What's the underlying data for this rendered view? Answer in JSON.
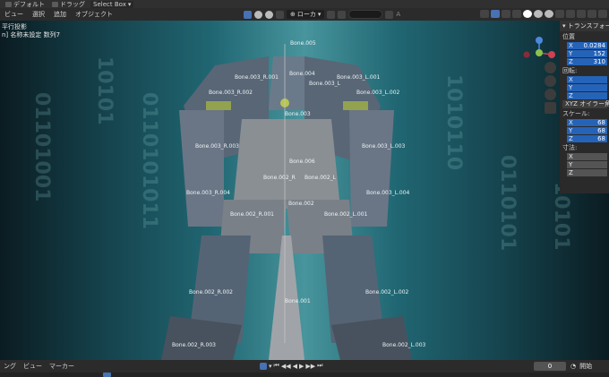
{
  "topbar": {
    "mode_label": "デフォルト",
    "drag_label": "ドラッグ",
    "select_label": "Select Box"
  },
  "header": {
    "menu": [
      "ビュー",
      "選択",
      "追加",
      "オブジェクト"
    ],
    "orientation_label": "ローカ",
    "search_placeholder": ""
  },
  "viewport": {
    "title_line1": "平行投影",
    "title_line2": "n] 名称未設定 数列7",
    "accent": "#2a8390"
  },
  "bones": [
    {
      "label": "Bone.005"
    },
    {
      "label": "Bone.004"
    },
    {
      "label": "Bone.003_R.001"
    },
    {
      "label": "Bone.003_L.001"
    },
    {
      "label": "Bone.003_L"
    },
    {
      "label": "Bone.003_R.002"
    },
    {
      "label": "Bone.003_L.002"
    },
    {
      "label": "Bone.003"
    },
    {
      "label": "Bone.003_R.003"
    },
    {
      "label": "Bone.003_L.003"
    },
    {
      "label": "Bone.006"
    },
    {
      "label": "Bone.002_R"
    },
    {
      "label": "Bone.002_L"
    },
    {
      "label": "Bone.003_R.004"
    },
    {
      "label": "Bone.003_L.004"
    },
    {
      "label": "Bone.002"
    },
    {
      "label": "Bone.002_R.001"
    },
    {
      "label": "Bone.002_L.001"
    },
    {
      "label": "Bone.002_R.002"
    },
    {
      "label": "Bone.002_L.002"
    },
    {
      "label": "Bone.001"
    },
    {
      "label": "Bone.002_R.003"
    },
    {
      "label": "Bone.002_L.003"
    }
  ],
  "npanel": {
    "title": "トランスフォー",
    "location_label": "位置",
    "location": [
      {
        "axis": "X",
        "value": "0.0284"
      },
      {
        "axis": "Y",
        "value": "152"
      },
      {
        "axis": "Z",
        "value": "310"
      }
    ],
    "rotation_label": "回転:",
    "rotation": [
      {
        "axis": "X",
        "value": ""
      },
      {
        "axis": "Y",
        "value": ""
      },
      {
        "axis": "Z",
        "value": ""
      }
    ],
    "euler_label": "XYZ オイラー角",
    "scale_label": "スケール:",
    "scale": [
      {
        "axis": "X",
        "value": "68"
      },
      {
        "axis": "Y",
        "value": "68"
      },
      {
        "axis": "Z",
        "value": "68"
      }
    ],
    "dimensions_label": "寸法:",
    "dimensions": [
      {
        "axis": "X",
        "value": ""
      },
      {
        "axis": "Y",
        "value": ""
      },
      {
        "axis": "Z",
        "value": ""
      }
    ]
  },
  "timeline": {
    "menu": [
      "ング",
      "ビュー",
      "マーカー"
    ],
    "frame": "0",
    "start_label": "開始"
  }
}
